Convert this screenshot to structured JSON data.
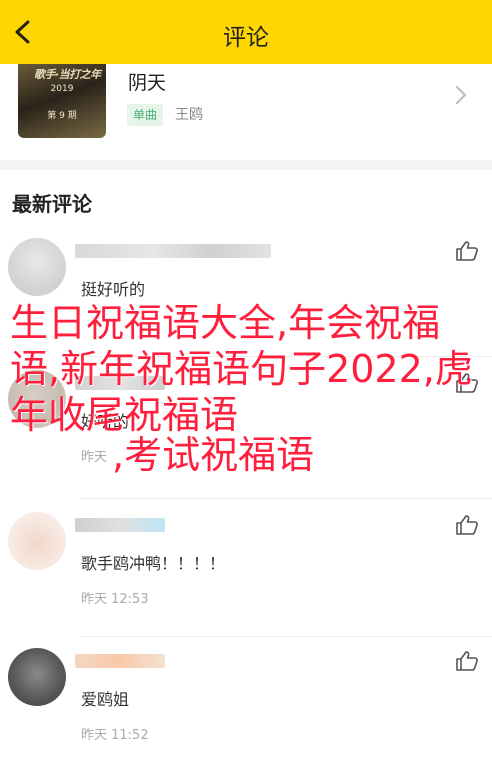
{
  "header": {
    "title": "评论",
    "back_icon": "chevron-left-icon"
  },
  "song": {
    "cover_title": "歌手·当打之年",
    "cover_year": "2019",
    "cover_episode": "第 9 期",
    "title": "阴天",
    "tag": "单曲",
    "artist": "王鸥"
  },
  "section_title": "最新评论",
  "comments": [
    {
      "text": "挺好听的",
      "time": ""
    },
    {
      "text": "好听的",
      "time": "昨天"
    },
    {
      "text": "歌手鸥冲鸭！！！！",
      "time": "昨天 12:53"
    },
    {
      "text": "爱鸥姐",
      "time": "昨天 11:52"
    }
  ],
  "overlay": {
    "line1": "生日祝福语大全,年会祝福语,新年祝福语句子2022,虎年收尾祝福语",
    "line2": ",考试祝福语"
  },
  "colors": {
    "header_bg": "#fed703",
    "overlay_text": "#ff1f3d",
    "tag_text": "#4caf73",
    "tag_bg": "#e6f4ea"
  }
}
